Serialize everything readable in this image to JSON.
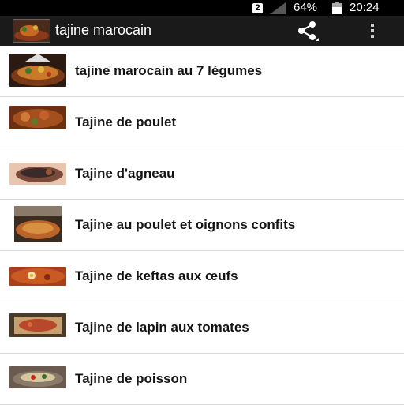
{
  "status_bar": {
    "sim_badge": "2",
    "battery_percent": "64%",
    "time": "20:24"
  },
  "app_bar": {
    "title": "tajine marocain",
    "app_icon": "tajine-photo",
    "share_icon": "share-icon",
    "overflow_icon": "overflow-menu-icon"
  },
  "recipes": [
    {
      "label": "tajine marocain au 7 légumes"
    },
    {
      "label": "Tajine de poulet"
    },
    {
      "label": "Tajine d'agneau"
    },
    {
      "label": "Tajine au poulet et oignons confits"
    },
    {
      "label": "Tajine de keftas aux œufs"
    },
    {
      "label": "Tajine de lapin aux tomates"
    },
    {
      "label": "Tajine de poisson"
    }
  ],
  "colors": {
    "status_bar": "#000000",
    "action_bar": "#1a1a1a",
    "row_divider": "#d9d9d9",
    "text": "#141414"
  }
}
